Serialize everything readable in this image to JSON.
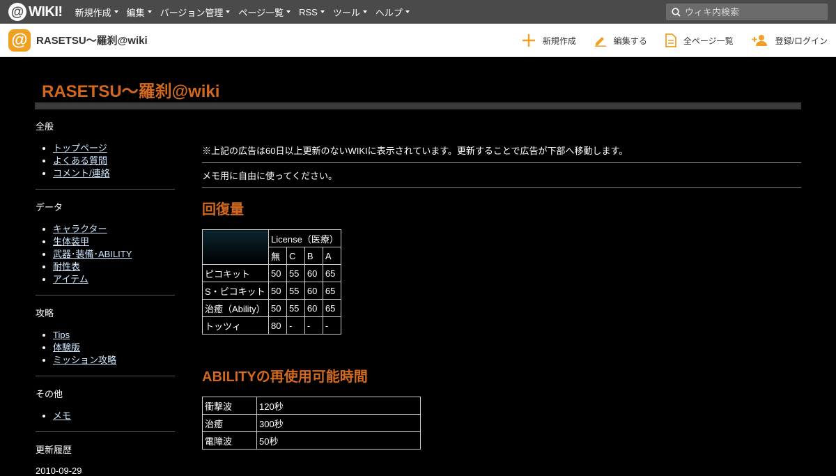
{
  "topbar": {
    "logo_text": "WIKI!",
    "nav": [
      "新規作成",
      "編集",
      "バージョン管理",
      "ページ一覧",
      "RSS",
      "ツール",
      "ヘルプ"
    ],
    "search_placeholder": "ウィキ内検索"
  },
  "header": {
    "site_name": "RASETSU～羅刹@wiki",
    "actions": {
      "new": "新規作成",
      "edit": "編集する",
      "all_pages": "全ページ一覧",
      "login": "登録/ログイン"
    }
  },
  "page": {
    "title": "RASETSU～羅刹@wiki"
  },
  "menu": {
    "sections": [
      {
        "title": "全般",
        "items": [
          "トップページ",
          "よくある質問",
          "コメント/連絡"
        ]
      },
      {
        "title": "データ",
        "items": [
          "キャラクター",
          "生体装甲",
          "武器･装備･ABILITY",
          "耐性表",
          "アイテム"
        ]
      },
      {
        "title": "攻略",
        "items": [
          "Tips",
          "体験版",
          "ミッション攻略"
        ]
      },
      {
        "title": "その他",
        "items": [
          "メモ"
        ]
      }
    ],
    "history_title": "更新履歴",
    "history_first_date": "2010-09-29"
  },
  "main": {
    "notice": "※上記の広告は60日以上更新のないWIKIに表示されています。更新することで広告が下部へ移動します。",
    "memo": "メモ用に自由に使ってください。",
    "heal": {
      "heading": "回復量",
      "license_header": "License（医療）",
      "cols": [
        "無",
        "C",
        "B",
        "A"
      ],
      "rows": [
        {
          "name": "ピコキット",
          "values": [
            "50",
            "55",
            "60",
            "65"
          ]
        },
        {
          "name": "S・ピコキット",
          "values": [
            "50",
            "55",
            "60",
            "65"
          ]
        },
        {
          "name": "治癒（Ability）",
          "values": [
            "50",
            "55",
            "60",
            "65"
          ]
        },
        {
          "name": "トッツィ",
          "values": [
            "80",
            "-",
            "-",
            "-"
          ]
        }
      ]
    },
    "ability": {
      "heading": "ABILITYの再使用可能時間",
      "rows": [
        {
          "name": "衝撃波",
          "value": "120秒"
        },
        {
          "name": "治癒",
          "value": "300秒"
        },
        {
          "name": "電障波",
          "value": "50秒"
        }
      ]
    }
  }
}
